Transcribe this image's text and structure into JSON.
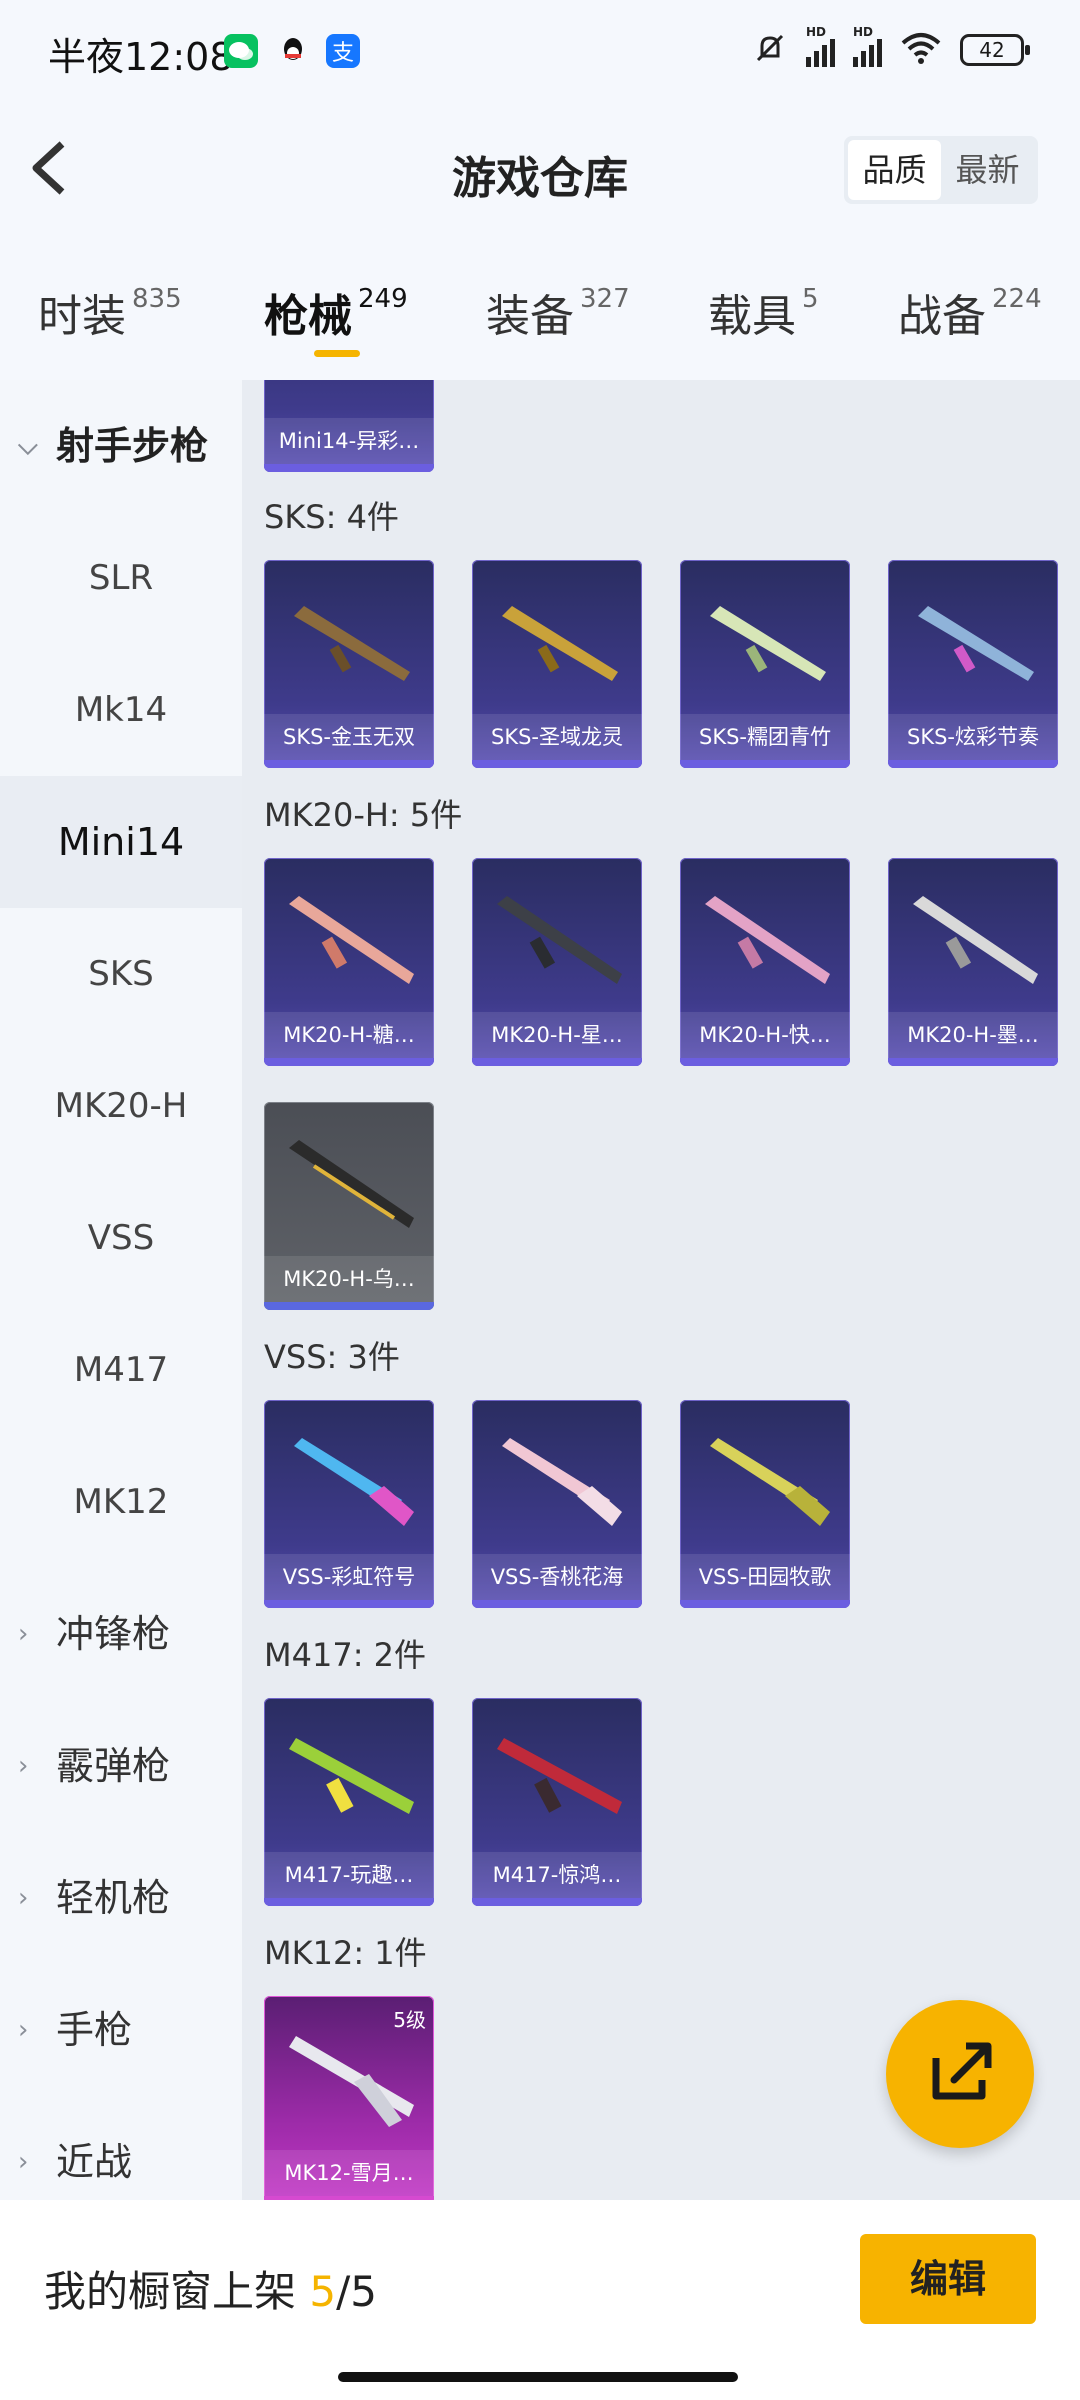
{
  "status_bar": {
    "time": "半夜12:08",
    "battery": "42",
    "network_badges": [
      "HD",
      "HD"
    ],
    "icons": [
      "wechat-icon",
      "qq-icon",
      "alipay-icon",
      "mute-icon",
      "signal-icon",
      "signal-icon",
      "wifi-icon",
      "battery-icon"
    ]
  },
  "header": {
    "title": "游戏仓库",
    "sort_options": [
      "品质",
      "最新"
    ],
    "sort_selected": "品质"
  },
  "category_tabs": [
    {
      "label": "时装",
      "count": "835"
    },
    {
      "label": "枪械",
      "count": "249"
    },
    {
      "label": "装备",
      "count": "327"
    },
    {
      "label": "载具",
      "count": "5"
    },
    {
      "label": "战备",
      "count": "224"
    }
  ],
  "active_tab": "枪械",
  "sidebar": {
    "groups": [
      {
        "label": "射手步枪",
        "expanded": true,
        "items": [
          "SLR",
          "Mk14",
          "Mini14",
          "SKS",
          "MK20-H",
          "VSS",
          "M417",
          "MK12"
        ]
      },
      {
        "label": "冲锋枪"
      },
      {
        "label": "霰弹枪"
      },
      {
        "label": "轻机枪"
      },
      {
        "label": "手枪"
      },
      {
        "label": "近战"
      }
    ],
    "active_item": "Mini14"
  },
  "sections": [
    {
      "title": "",
      "items": [
        {
          "name": "Mini14-异彩…"
        }
      ]
    },
    {
      "title": "SKS: 4件",
      "items": [
        {
          "name": "SKS-金玉无双"
        },
        {
          "name": "SKS-圣域龙灵"
        },
        {
          "name": "SKS-糯团青竹"
        },
        {
          "name": "SKS-炫彩节奏"
        }
      ]
    },
    {
      "title": "MK20-H: 5件",
      "items": [
        {
          "name": "MK20-H-糖…"
        },
        {
          "name": "MK20-H-星…"
        },
        {
          "name": "MK20-H-快…"
        },
        {
          "name": "MK20-H-墨…"
        },
        {
          "name": "MK20-H-乌…"
        }
      ]
    },
    {
      "title": "VSS: 3件",
      "items": [
        {
          "name": "VSS-彩虹符号"
        },
        {
          "name": "VSS-香桃花海"
        },
        {
          "name": "VSS-田园牧歌"
        }
      ]
    },
    {
      "title": "M417: 2件",
      "items": [
        {
          "name": "M417-玩趣…"
        },
        {
          "name": "M417-惊鸿…"
        }
      ]
    },
    {
      "title": "MK12: 1件",
      "items": [
        {
          "name": "MK12-雪月…",
          "level": "5级"
        }
      ]
    }
  ],
  "bottom_bar": {
    "label": "我的橱窗上架",
    "count_current": "5",
    "separator": "/",
    "count_total": "5",
    "edit_label": "编辑"
  },
  "colors": {
    "accent": "#f7b300",
    "card_purple": "#3f3b8c",
    "card_grey": "#5a5d63",
    "card_pink": "#9c2ba8"
  }
}
